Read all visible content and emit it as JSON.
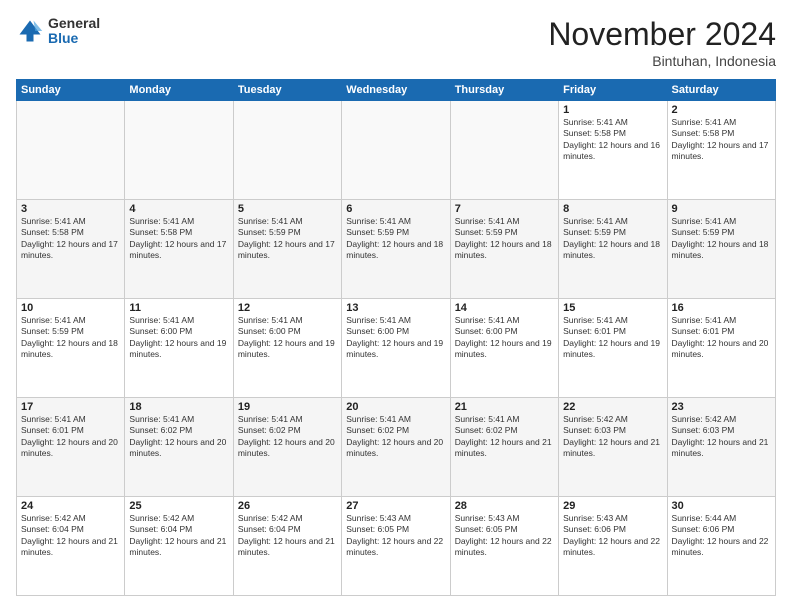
{
  "logo": {
    "general": "General",
    "blue": "Blue"
  },
  "header": {
    "month": "November 2024",
    "location": "Bintuhan, Indonesia"
  },
  "weekdays": [
    "Sunday",
    "Monday",
    "Tuesday",
    "Wednesday",
    "Thursday",
    "Friday",
    "Saturday"
  ],
  "weeks": [
    [
      {
        "day": "",
        "info": ""
      },
      {
        "day": "",
        "info": ""
      },
      {
        "day": "",
        "info": ""
      },
      {
        "day": "",
        "info": ""
      },
      {
        "day": "",
        "info": ""
      },
      {
        "day": "1",
        "info": "Sunrise: 5:41 AM\nSunset: 5:58 PM\nDaylight: 12 hours and 16 minutes."
      },
      {
        "day": "2",
        "info": "Sunrise: 5:41 AM\nSunset: 5:58 PM\nDaylight: 12 hours and 17 minutes."
      }
    ],
    [
      {
        "day": "3",
        "info": "Sunrise: 5:41 AM\nSunset: 5:58 PM\nDaylight: 12 hours and 17 minutes."
      },
      {
        "day": "4",
        "info": "Sunrise: 5:41 AM\nSunset: 5:58 PM\nDaylight: 12 hours and 17 minutes."
      },
      {
        "day": "5",
        "info": "Sunrise: 5:41 AM\nSunset: 5:59 PM\nDaylight: 12 hours and 17 minutes."
      },
      {
        "day": "6",
        "info": "Sunrise: 5:41 AM\nSunset: 5:59 PM\nDaylight: 12 hours and 18 minutes."
      },
      {
        "day": "7",
        "info": "Sunrise: 5:41 AM\nSunset: 5:59 PM\nDaylight: 12 hours and 18 minutes."
      },
      {
        "day": "8",
        "info": "Sunrise: 5:41 AM\nSunset: 5:59 PM\nDaylight: 12 hours and 18 minutes."
      },
      {
        "day": "9",
        "info": "Sunrise: 5:41 AM\nSunset: 5:59 PM\nDaylight: 12 hours and 18 minutes."
      }
    ],
    [
      {
        "day": "10",
        "info": "Sunrise: 5:41 AM\nSunset: 5:59 PM\nDaylight: 12 hours and 18 minutes."
      },
      {
        "day": "11",
        "info": "Sunrise: 5:41 AM\nSunset: 6:00 PM\nDaylight: 12 hours and 19 minutes."
      },
      {
        "day": "12",
        "info": "Sunrise: 5:41 AM\nSunset: 6:00 PM\nDaylight: 12 hours and 19 minutes."
      },
      {
        "day": "13",
        "info": "Sunrise: 5:41 AM\nSunset: 6:00 PM\nDaylight: 12 hours and 19 minutes."
      },
      {
        "day": "14",
        "info": "Sunrise: 5:41 AM\nSunset: 6:00 PM\nDaylight: 12 hours and 19 minutes."
      },
      {
        "day": "15",
        "info": "Sunrise: 5:41 AM\nSunset: 6:01 PM\nDaylight: 12 hours and 19 minutes."
      },
      {
        "day": "16",
        "info": "Sunrise: 5:41 AM\nSunset: 6:01 PM\nDaylight: 12 hours and 20 minutes."
      }
    ],
    [
      {
        "day": "17",
        "info": "Sunrise: 5:41 AM\nSunset: 6:01 PM\nDaylight: 12 hours and 20 minutes."
      },
      {
        "day": "18",
        "info": "Sunrise: 5:41 AM\nSunset: 6:02 PM\nDaylight: 12 hours and 20 minutes."
      },
      {
        "day": "19",
        "info": "Sunrise: 5:41 AM\nSunset: 6:02 PM\nDaylight: 12 hours and 20 minutes."
      },
      {
        "day": "20",
        "info": "Sunrise: 5:41 AM\nSunset: 6:02 PM\nDaylight: 12 hours and 20 minutes."
      },
      {
        "day": "21",
        "info": "Sunrise: 5:41 AM\nSunset: 6:02 PM\nDaylight: 12 hours and 21 minutes."
      },
      {
        "day": "22",
        "info": "Sunrise: 5:42 AM\nSunset: 6:03 PM\nDaylight: 12 hours and 21 minutes."
      },
      {
        "day": "23",
        "info": "Sunrise: 5:42 AM\nSunset: 6:03 PM\nDaylight: 12 hours and 21 minutes."
      }
    ],
    [
      {
        "day": "24",
        "info": "Sunrise: 5:42 AM\nSunset: 6:04 PM\nDaylight: 12 hours and 21 minutes."
      },
      {
        "day": "25",
        "info": "Sunrise: 5:42 AM\nSunset: 6:04 PM\nDaylight: 12 hours and 21 minutes."
      },
      {
        "day": "26",
        "info": "Sunrise: 5:42 AM\nSunset: 6:04 PM\nDaylight: 12 hours and 21 minutes."
      },
      {
        "day": "27",
        "info": "Sunrise: 5:43 AM\nSunset: 6:05 PM\nDaylight: 12 hours and 22 minutes."
      },
      {
        "day": "28",
        "info": "Sunrise: 5:43 AM\nSunset: 6:05 PM\nDaylight: 12 hours and 22 minutes."
      },
      {
        "day": "29",
        "info": "Sunrise: 5:43 AM\nSunset: 6:06 PM\nDaylight: 12 hours and 22 minutes."
      },
      {
        "day": "30",
        "info": "Sunrise: 5:44 AM\nSunset: 6:06 PM\nDaylight: 12 hours and 22 minutes."
      }
    ]
  ]
}
